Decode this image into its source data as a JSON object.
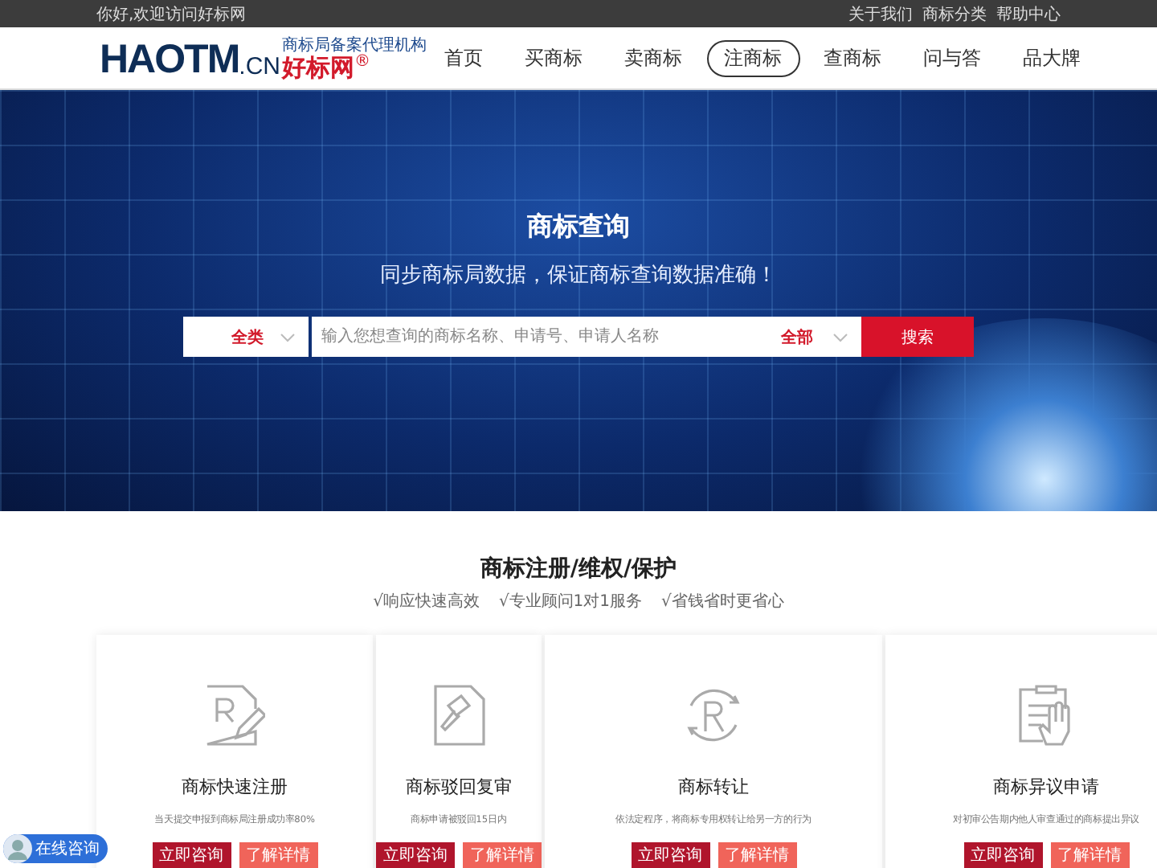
{
  "top_bar": {
    "greeting": "你好,欢迎访问好标网",
    "links": [
      "关于我们",
      "商标分类",
      "帮助中心"
    ]
  },
  "logo": {
    "brand": "HAOTM",
    "domain": ".CN",
    "tagline": "商标局备案代理机构",
    "name": "好标网",
    "mark": "®"
  },
  "nav": [
    {
      "label": "首页",
      "selected": false
    },
    {
      "label": "买商标",
      "selected": false
    },
    {
      "label": "卖商标",
      "selected": false
    },
    {
      "label": "注商标",
      "selected": true
    },
    {
      "label": "查商标",
      "selected": false
    },
    {
      "label": "问与答",
      "selected": false
    },
    {
      "label": "品大牌",
      "selected": false
    }
  ],
  "banner": {
    "title": "商标查询",
    "subtitle": "同步商标局数据，保证商标查询数据准确！"
  },
  "search": {
    "category": "全类",
    "placeholder": "输入您想查询的商标名称、申请号、申请人名称",
    "scope": "全部",
    "button": "搜索"
  },
  "services": {
    "title": "商标注册/维权/保护",
    "features": [
      "√响应快速高效",
      "√专业顾问1对1服务",
      "√省钱省时更省心"
    ],
    "cards": [
      {
        "kind": "register",
        "title": "商标快速注册",
        "desc": "当天提交申报到商标局注册成功率80%",
        "primary": "立即咨询",
        "secondary": "了解详情"
      },
      {
        "kind": "review",
        "title": "商标驳回复审",
        "desc": "商标申请被驳回15日内",
        "primary": "立即咨询",
        "secondary": "了解详情"
      },
      {
        "kind": "transfer",
        "title": "商标转让",
        "desc": "依法定程序，将商标专用权转让给另一方的行为",
        "primary": "立即咨询",
        "secondary": "了解详情"
      },
      {
        "kind": "objection",
        "title": "商标异议申请",
        "desc": "对初审公告期内他人审查通过的商标提出异议",
        "primary": "立即咨询",
        "secondary": "了解详情"
      }
    ]
  },
  "chat_widget": {
    "label": "在线咨询"
  }
}
